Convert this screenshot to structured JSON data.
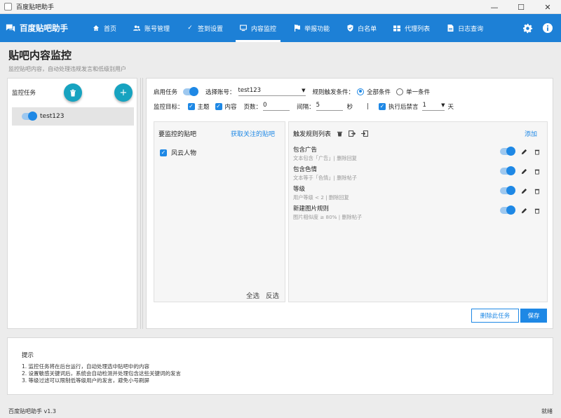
{
  "window": {
    "title": "百度贴吧助手"
  },
  "nav": {
    "brand": "百度贴吧助手",
    "items": [
      {
        "label": "首页",
        "icon": "home-icon"
      },
      {
        "label": "账号管理",
        "icon": "users-icon"
      },
      {
        "label": "签到设置",
        "icon": "check-icon"
      },
      {
        "label": "内容监控",
        "icon": "monitor-icon"
      },
      {
        "label": "举报功能",
        "icon": "flag-icon"
      },
      {
        "label": "白名单",
        "icon": "shield-icon"
      },
      {
        "label": "代理列表",
        "icon": "list-icon"
      },
      {
        "label": "日志查询",
        "icon": "file-icon"
      }
    ],
    "active": "内容监控"
  },
  "page": {
    "title": "贴吧内容监控",
    "subtitle": "监控贴吧内容，自动处理违规发言和低级别用户"
  },
  "left": {
    "label": "监控任务",
    "tasks": [
      {
        "name": "test123",
        "enabled": true
      }
    ]
  },
  "config": {
    "enable_label": "启用任务",
    "enabled": true,
    "account_label": "选择账号：",
    "account_value": "test123",
    "trigger_label": "规则触发条件：",
    "trigger_all": "全部条件",
    "trigger_single": "单一条件",
    "target_label": "监控目标：",
    "target_topic": "主题",
    "target_content": "内容",
    "pages_label": "页数：",
    "pages_value": "0",
    "interval_label": "间隔：",
    "interval_value": "5",
    "interval_unit": "秒",
    "separator": "|",
    "ban_label": "执行后禁言",
    "ban_value": "1",
    "ban_unit": "天"
  },
  "forums": {
    "title": "要监控的贴吧",
    "fetch_link": "获取关注的贴吧",
    "items": [
      {
        "name": "风云人物",
        "checked": true
      }
    ],
    "select_all": "全选",
    "invert": "反选"
  },
  "rules": {
    "title": "触发规则列表",
    "add": "添加",
    "items": [
      {
        "name": "包含广告",
        "desc": "文本包含「广告」| 删除回复",
        "enabled": true
      },
      {
        "name": "包含色情",
        "desc": "文本等于「色情」| 删除帖子",
        "enabled": true
      },
      {
        "name": "等级",
        "desc": "用户等级 < 2 | 删除回复",
        "enabled": true
      },
      {
        "name": "新建图片规则",
        "desc": "图片相似度 ≥ 80% | 删除帖子",
        "enabled": true
      }
    ]
  },
  "actions": {
    "delete_task": "删除此任务",
    "save": "保存"
  },
  "tips": {
    "heading": "提示",
    "lines": [
      "1. 监控任务将在后台运行，自动处理选中贴吧中的内容",
      "2. 设置敏感关键词后，系统会自动检测并处理包含这些关键词的发言",
      "3. 等级过滤可以限制低等级用户的发言，避免小号刷屏"
    ]
  },
  "status": {
    "version": "百度贴吧助手 v1.3",
    "state": "就绪"
  },
  "colors": {
    "primary": "#1d80d6",
    "accent": "#17a3c0",
    "toggle": "#1e88e5"
  }
}
